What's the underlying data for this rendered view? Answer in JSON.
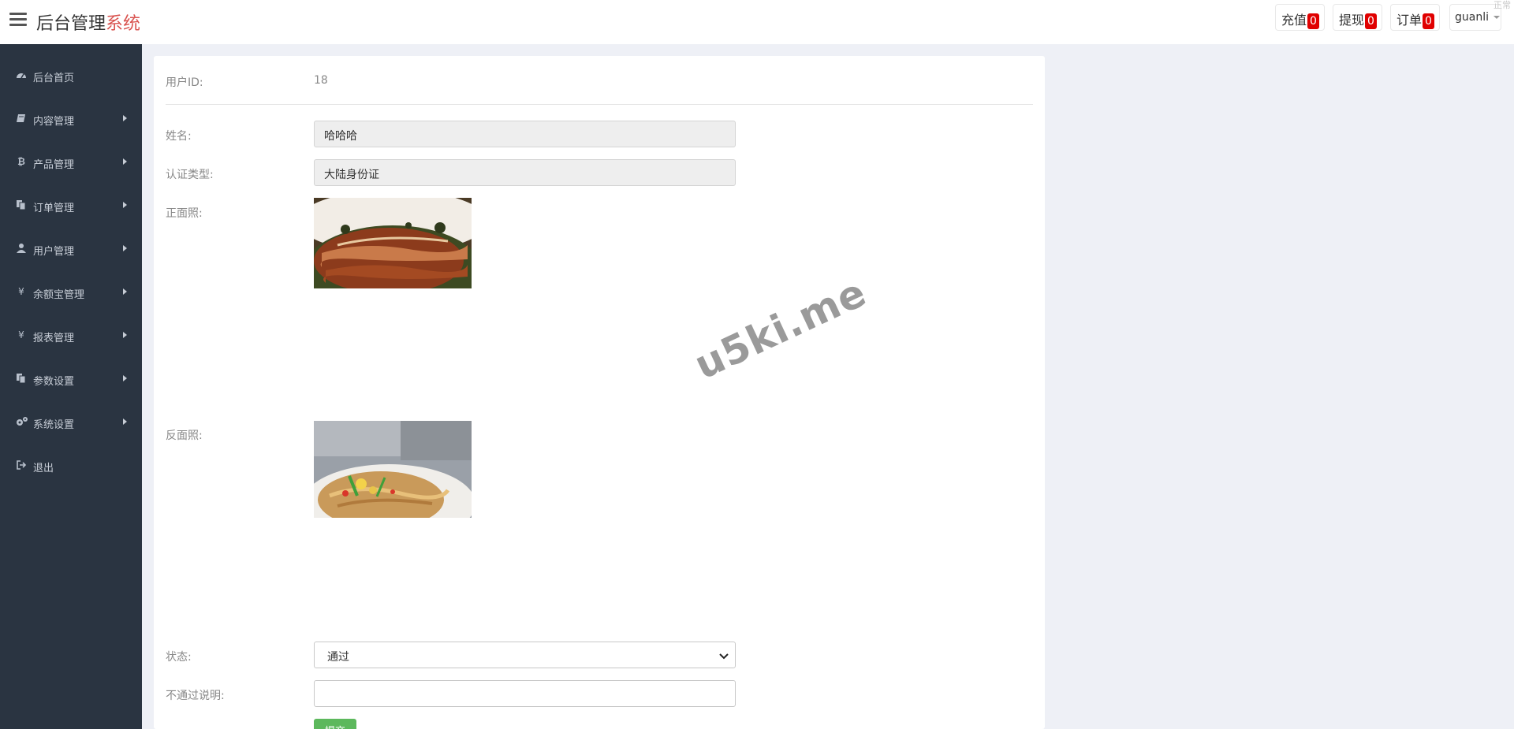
{
  "header": {
    "title_main": "后台管理",
    "title_accent": "系统",
    "recharge_label": "充值",
    "recharge_count": "0",
    "withdraw_label": "提现",
    "withdraw_count": "0",
    "order_label": "订单",
    "order_count": "0",
    "username": "guanli",
    "corner_text": "正常"
  },
  "sidebar": {
    "items": [
      {
        "label": "后台首页",
        "icon": "dashboard-icon",
        "has_submenu": false
      },
      {
        "label": "内容管理",
        "icon": "book-icon",
        "has_submenu": true
      },
      {
        "label": "产品管理",
        "icon": "bitcoin-icon",
        "has_submenu": true
      },
      {
        "label": "订单管理",
        "icon": "files-icon",
        "has_submenu": true
      },
      {
        "label": "用户管理",
        "icon": "user-icon",
        "has_submenu": true
      },
      {
        "label": "余额宝管理",
        "icon": "yen-icon",
        "has_submenu": true
      },
      {
        "label": "报表管理",
        "icon": "yen-icon",
        "has_submenu": true
      },
      {
        "label": "参数设置",
        "icon": "files-icon",
        "has_submenu": true
      },
      {
        "label": "系统设置",
        "icon": "gears-icon",
        "has_submenu": true
      },
      {
        "label": "退出",
        "icon": "sign-out-icon",
        "has_submenu": false
      }
    ]
  },
  "form": {
    "user_id_label": "用户ID:",
    "user_id_value": "18",
    "name_label": "姓名:",
    "name_value": "哈哈哈",
    "cert_type_label": "认证类型:",
    "cert_type_value": "大陆身份证",
    "front_photo_label": "正面照:",
    "back_photo_label": "反面照:",
    "status_label": "状态:",
    "status_value": "通过",
    "reject_reason_label": "不通过说明:",
    "reject_reason_value": "",
    "submit_label": "提交"
  },
  "watermark": "u5ki.me",
  "colors": {
    "sidebar_bg": "#2a3441",
    "accent_red": "#d9534f",
    "badge_red": "#e00000",
    "submit_green": "#5cb85c",
    "page_bg": "#eef0f6"
  }
}
